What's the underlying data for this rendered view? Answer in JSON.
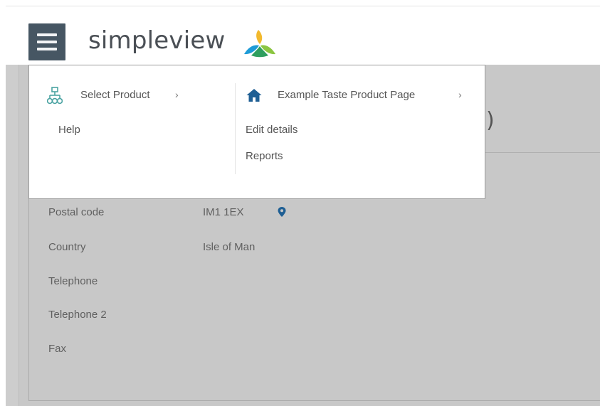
{
  "header": {
    "menu_button": "menu",
    "logo_text": "simpleview",
    "logo_colors": [
      "#f2b92e",
      "#1d9bd7",
      "#8bc541",
      "#2e9e5e"
    ]
  },
  "dropdown": {
    "left": {
      "heading": "Select Product",
      "heading_icon": "sitemap-icon",
      "items": [
        "Help"
      ]
    },
    "right": {
      "heading": "Example Taste Product Page",
      "heading_icon": "home-icon",
      "items": [
        "Edit details",
        "Reports"
      ]
    },
    "chevron": "›"
  },
  "page": {
    "title_fragment": ")",
    "fields": [
      {
        "label": "Postal code",
        "value": "IM1 1EX",
        "icon": "map-pin-icon"
      },
      {
        "label": "Country",
        "value": "Isle of Man"
      },
      {
        "label": "Telephone",
        "value": ""
      },
      {
        "label": "Telephone 2",
        "value": ""
      },
      {
        "label": "Fax",
        "value": ""
      }
    ]
  },
  "colors": {
    "header_button": "#465663",
    "overlay_gray": "#c8c8c8",
    "icon_blue": "#1f5f94",
    "sitemap_teal": "#4aa3a2"
  }
}
